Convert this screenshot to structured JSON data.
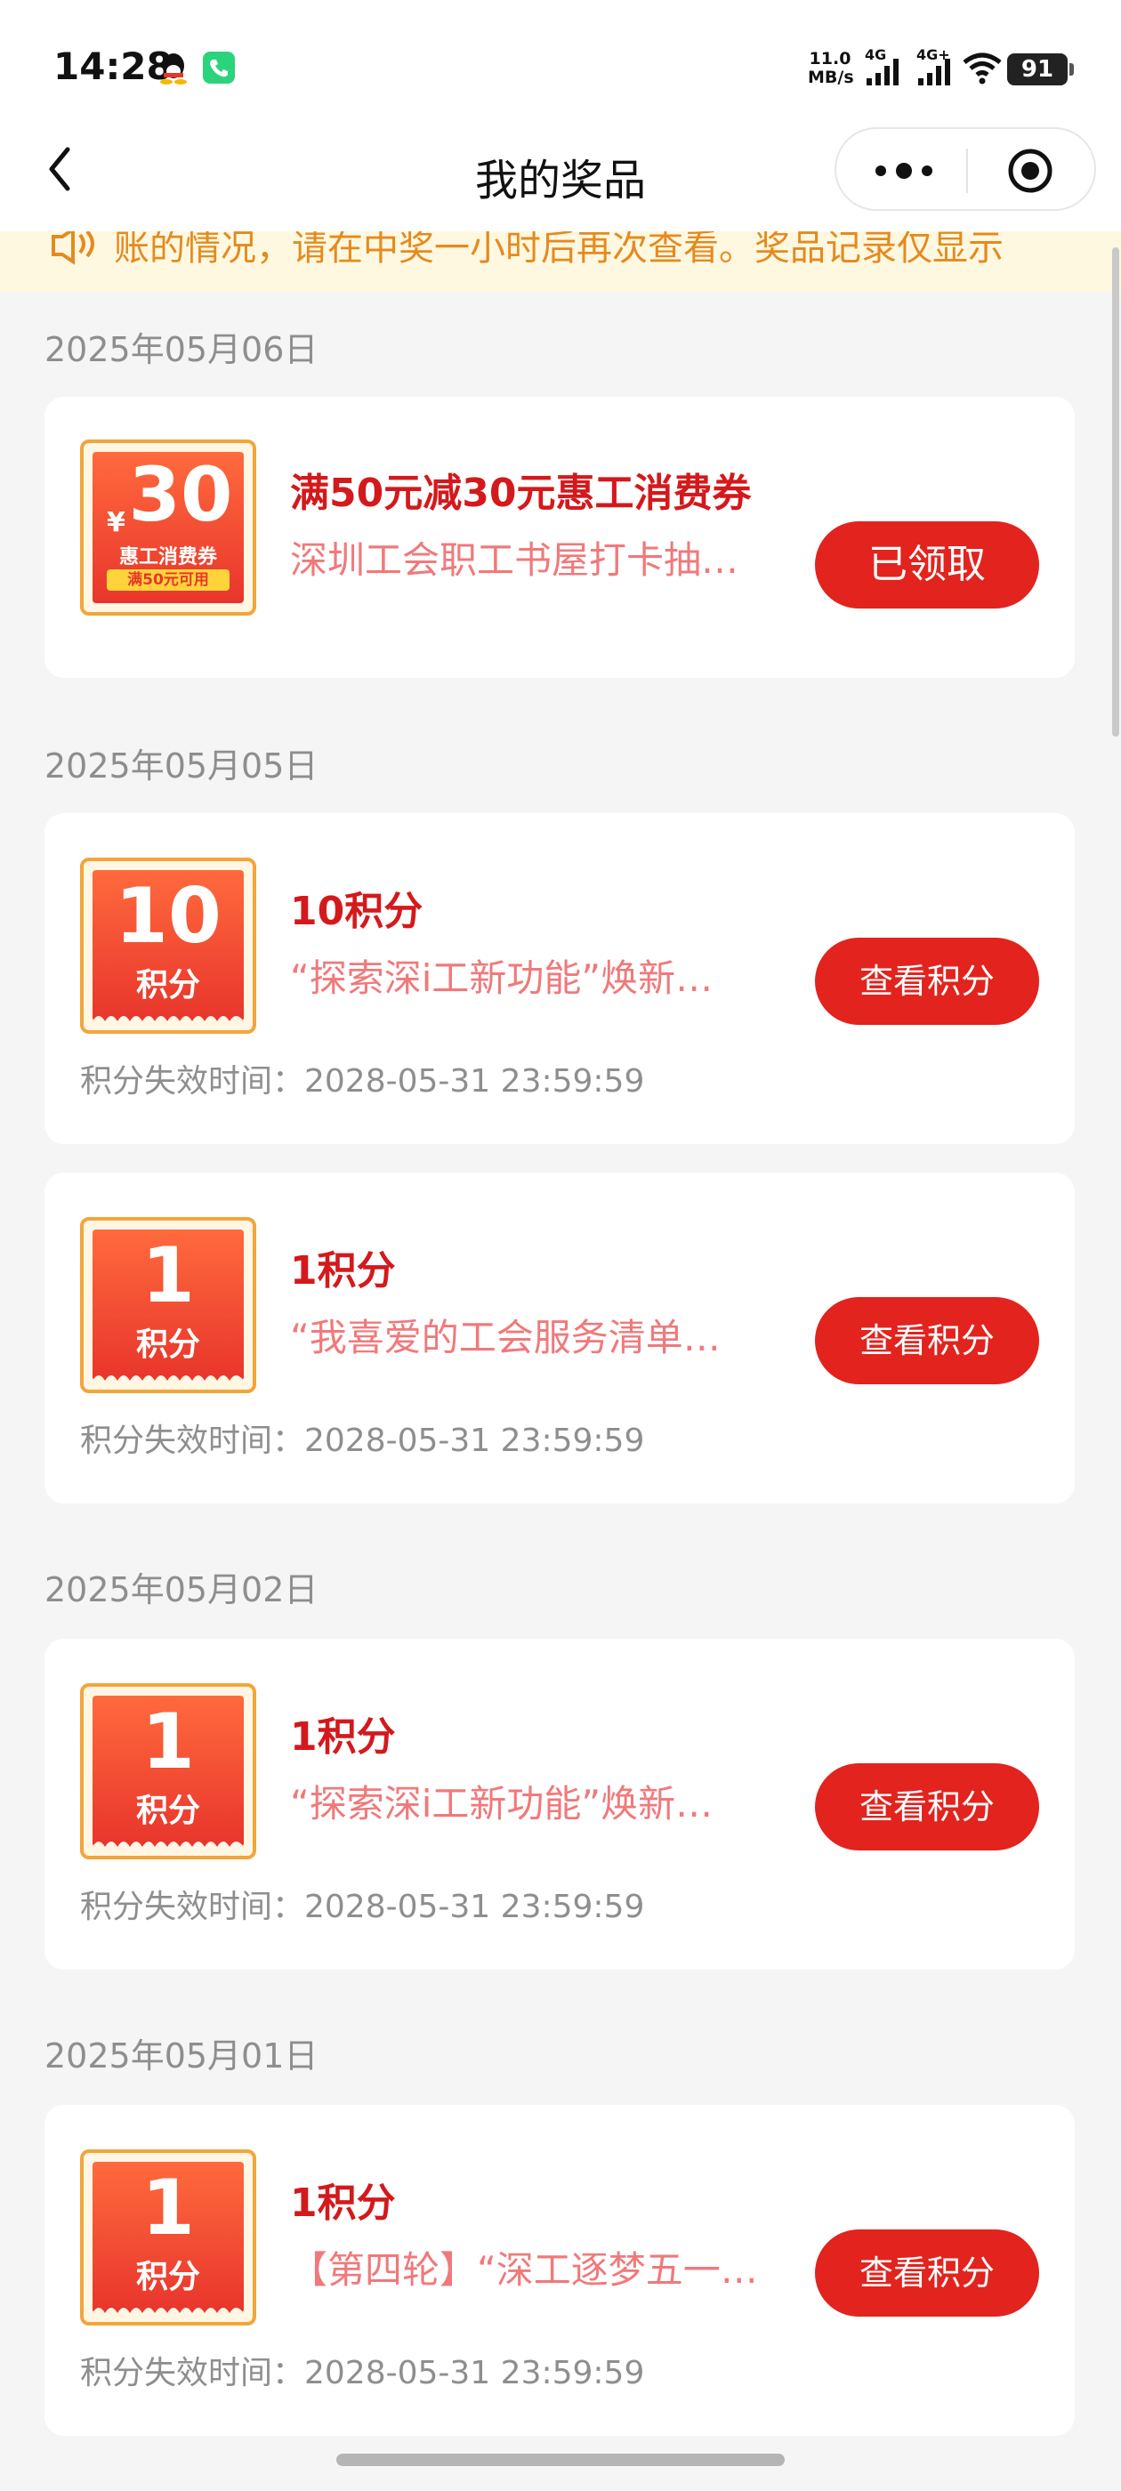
{
  "status_bar": {
    "time": "14:28",
    "network_speed_value": "11.0",
    "network_speed_unit": "MB/s",
    "sim1_label": "4G",
    "sim2_label": "4G+",
    "battery": "91"
  },
  "nav": {
    "title": "我的奖品"
  },
  "notice": {
    "text": "账的情况，请在中奖一小时后再次查看。奖品记录仅显示"
  },
  "colors": {
    "accent_red": "#e2231e",
    "title_red": "#d4191c",
    "desc_pink": "#f0797b",
    "ticket_border": "#f3a53a",
    "notice_orange": "#e58a1e"
  },
  "groups": [
    {
      "date": "2025年05月06日",
      "items": [
        {
          "type": "coupon",
          "ticket_yen": "¥",
          "ticket_value": "30",
          "ticket_name": "惠工消费券",
          "ticket_condition": "满50元可用",
          "title": "满50元减30元惠工消费券",
          "desc": "深圳工会职工书屋打卡抽…",
          "button": "已领取"
        }
      ]
    },
    {
      "date": "2025年05月05日",
      "items": [
        {
          "type": "points",
          "ticket_value": "10",
          "ticket_unit": "积分",
          "title": "10积分",
          "desc": "“探索深i工新功能”焕新…",
          "button": "查看积分",
          "expire": "积分失效时间：2028-05-31 23:59:59"
        },
        {
          "type": "points",
          "ticket_value": "1",
          "ticket_unit": "积分",
          "title": "1积分",
          "desc": "“我喜爱的工会服务清单…",
          "button": "查看积分",
          "expire": "积分失效时间：2028-05-31 23:59:59"
        }
      ]
    },
    {
      "date": "2025年05月02日",
      "items": [
        {
          "type": "points",
          "ticket_value": "1",
          "ticket_unit": "积分",
          "title": "1积分",
          "desc": "“探索深i工新功能”焕新…",
          "button": "查看积分",
          "expire": "积分失效时间：2028-05-31 23:59:59"
        }
      ]
    },
    {
      "date": "2025年05月01日",
      "items": [
        {
          "type": "points",
          "ticket_value": "1",
          "ticket_unit": "积分",
          "title": "1积分",
          "desc": "【第四轮】“深工逐梦五一…",
          "button": "查看积分",
          "expire": "积分失效时间：2028-05-31 23:59:59"
        }
      ]
    }
  ]
}
